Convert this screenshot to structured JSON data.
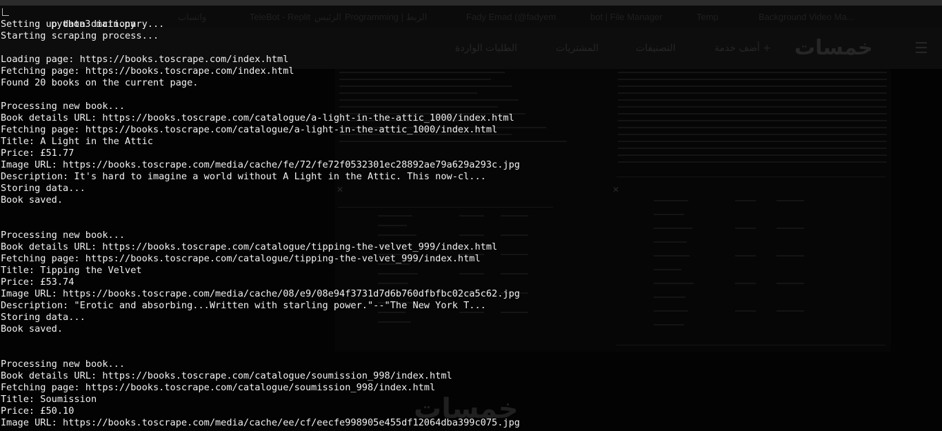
{
  "background": {
    "bookmarks": [
      "واتساب",
      "TeleBot - Replit",
      "الرئيس",
      "Programming | الربط",
      "Fady Emad (@fadyem",
      "bot | File Manager",
      "Temp",
      "Background Video Ma..."
    ],
    "navbar": {
      "brand": "خمسات",
      "items": [
        "أضف خدمة +",
        "التصنيفات",
        "المشتريات",
        "الطلبات الواردة"
      ]
    },
    "watermark": "خمسات"
  },
  "terminal": {
    "prompt_command": "python3 main.py",
    "lines": [
      "Setting up data dictionary...",
      "Starting scraping process...",
      "",
      "Loading page: https://books.toscrape.com/index.html",
      "Fetching page: https://books.toscrape.com/index.html",
      "Found 20 books on the current page.",
      "",
      "Processing new book...",
      "Book details URL: https://books.toscrape.com/catalogue/a-light-in-the-attic_1000/index.html",
      "Fetching page: https://books.toscrape.com/catalogue/a-light-in-the-attic_1000/index.html",
      "Title: A Light in the Attic",
      "Price: £51.77",
      "Image URL: https://books.toscrape.com/media/cache/fe/72/fe72f0532301ec28892ae79a629a293c.jpg",
      "Description: It's hard to imagine a world without A Light in the Attic. This now-cl...",
      "Storing data...",
      "Book saved.",
      "",
      "",
      "Processing new book...",
      "Book details URL: https://books.toscrape.com/catalogue/tipping-the-velvet_999/index.html",
      "Fetching page: https://books.toscrape.com/catalogue/tipping-the-velvet_999/index.html",
      "Title: Tipping the Velvet",
      "Price: £53.74",
      "Image URL: https://books.toscrape.com/media/cache/08/e9/08e94f3731d7d6b760dfbfbc02ca5c62.jpg",
      "Description: \"Erotic and absorbing...Written with starling power.\"--\"The New York T...",
      "Storing data...",
      "Book saved.",
      "",
      "",
      "Processing new book...",
      "Book details URL: https://books.toscrape.com/catalogue/soumission_998/index.html",
      "Fetching page: https://books.toscrape.com/catalogue/soumission_998/index.html",
      "Title: Soumission",
      "Price: £50.10",
      "Image URL: https://books.toscrape.com/media/cache/ee/cf/eecfe998905e455df12064dba399c075.jpg"
    ]
  }
}
